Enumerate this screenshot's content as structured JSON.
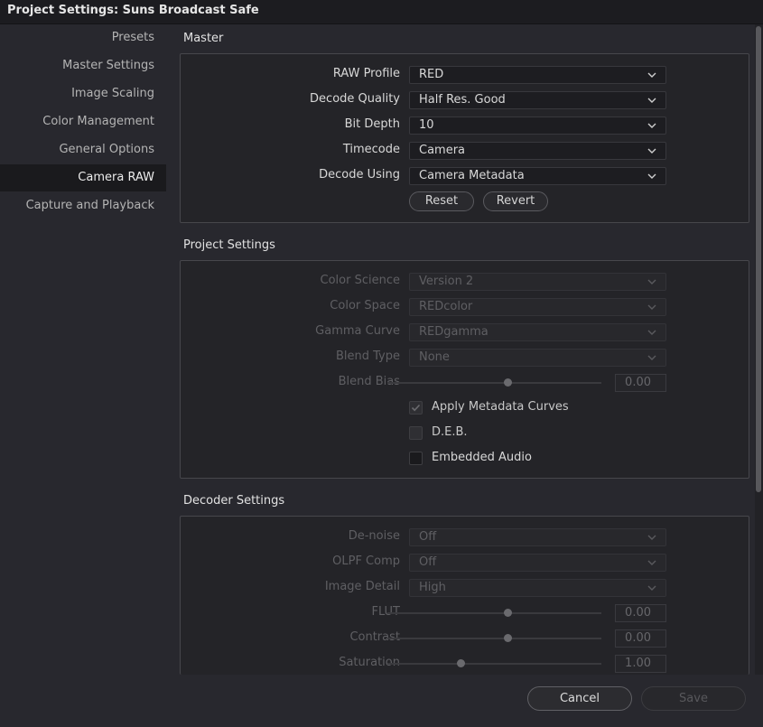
{
  "window": {
    "title": "Project Settings:  Suns Broadcast Safe"
  },
  "sidebar": {
    "items": [
      {
        "label": "Presets"
      },
      {
        "label": "Master Settings"
      },
      {
        "label": "Image Scaling"
      },
      {
        "label": "Color Management"
      },
      {
        "label": "General Options"
      },
      {
        "label": "Camera RAW"
      },
      {
        "label": "Capture and Playback"
      }
    ],
    "active_item": "Camera RAW"
  },
  "master": {
    "title": "Master",
    "raw_profile": {
      "label": "RAW Profile",
      "value": "RED"
    },
    "decode_quality": {
      "label": "Decode Quality",
      "value": "Half Res. Good"
    },
    "bit_depth": {
      "label": "Bit Depth",
      "value": "10"
    },
    "timecode": {
      "label": "Timecode",
      "value": "Camera"
    },
    "decode_using": {
      "label": "Decode Using",
      "value": "Camera Metadata"
    },
    "reset_label": "Reset",
    "revert_label": "Revert"
  },
  "project_settings": {
    "title": "Project Settings",
    "color_science": {
      "label": "Color Science",
      "value": "Version 2"
    },
    "color_space": {
      "label": "Color Space",
      "value": "REDcolor"
    },
    "gamma_curve": {
      "label": "Gamma Curve",
      "value": "REDgamma"
    },
    "blend_type": {
      "label": "Blend Type",
      "value": "None"
    },
    "blend_bias": {
      "label": "Blend Bias",
      "value": "0.00"
    },
    "apply_metadata_curves": {
      "label": "Apply Metadata Curves",
      "checked": true
    },
    "deb": {
      "label": "D.E.B.",
      "checked": false
    },
    "embedded_audio": {
      "label": "Embedded Audio",
      "checked": false
    }
  },
  "decoder_settings": {
    "title": "Decoder Settings",
    "denoise": {
      "label": "De-noise",
      "value": "Off"
    },
    "olpf_comp": {
      "label": "OLPF Comp",
      "value": "Off"
    },
    "image_detail": {
      "label": "Image Detail",
      "value": "High"
    },
    "flut": {
      "label": "FLUT",
      "value": "0.00"
    },
    "contrast": {
      "label": "Contrast",
      "value": "0.00"
    },
    "saturation": {
      "label": "Saturation",
      "value": "1.00"
    }
  },
  "footer": {
    "cancel_label": "Cancel",
    "save_label": "Save"
  },
  "colors": {
    "background": "#28282e",
    "panel": "#242428",
    "active_nav": "#1a1a1d"
  },
  "icons": {
    "dropdown": "chevron-down-icon",
    "checkmark": "checkmark-icon"
  }
}
